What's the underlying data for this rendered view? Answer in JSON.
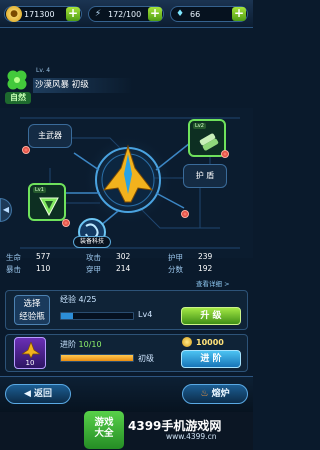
{
  "resources": [
    {
      "icon": "coin-icon",
      "value": "171300"
    },
    {
      "icon": "energy-icon",
      "value": "172/100"
    },
    {
      "icon": "diamond-icon",
      "value": "66"
    }
  ],
  "ship": {
    "level": "Lv. 4",
    "name": "沙漠风暴 初级",
    "element_label": "自然",
    "element_color": "#38c23a"
  },
  "hub": {
    "main_weapon_label": "主武器",
    "armor_label": "护 盾",
    "slot_left_level": "Lv1",
    "slot_right_level": "Lv2",
    "tech_label": "装备科技"
  },
  "stats": {
    "rows": [
      [
        {
          "k": "生命",
          "v": "577"
        },
        {
          "k": "攻击",
          "v": "302"
        },
        {
          "k": "护甲",
          "v": "239"
        }
      ],
      [
        {
          "k": "暴击",
          "v": "110"
        },
        {
          "k": "穿甲",
          "v": "214"
        },
        {
          "k": "分数",
          "v": "192"
        }
      ]
    ],
    "detail_link": "查看详细 >"
  },
  "upgrade": {
    "select_label": "选择经验瓶",
    "select_line1": "选择",
    "select_line2": "经验瓶",
    "exp_label": "经验",
    "exp_value": "4/25",
    "exp_fraction": 0.16,
    "level_tag": "Lv4",
    "button_label": "升 级"
  },
  "advance": {
    "item_count": "10",
    "label": "进阶",
    "value": "10/10",
    "fraction": 1.0,
    "grade": "初级",
    "cost": "10000",
    "button_label": "进 阶"
  },
  "bottom": {
    "back_label": "返回",
    "forge_label": "熔炉"
  },
  "watermark": {
    "logo_line1": "游戏",
    "logo_line2": "大全",
    "text": "4399手机游戏网",
    "url": "www.4399.cn"
  },
  "colors": {
    "accent_green": "#6fe25c",
    "accent_blue": "#4cc3f2",
    "gold": "#ffcf3a"
  }
}
